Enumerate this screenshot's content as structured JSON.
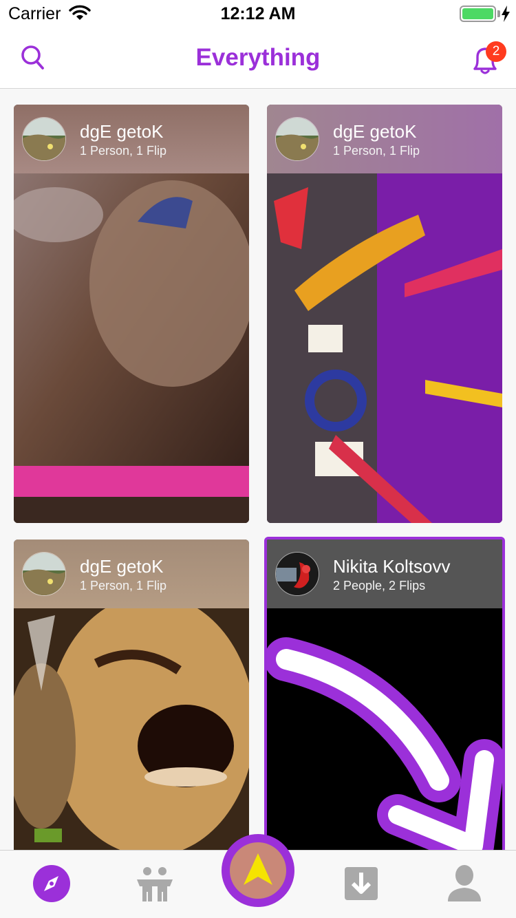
{
  "status_bar": {
    "carrier": "Carrier",
    "time": "12:12 AM",
    "battery_level": 1.0
  },
  "header": {
    "title": "Everything",
    "notification_count": "2",
    "icons": [
      "search-icon",
      "bell-icon"
    ]
  },
  "feed": {
    "cards": [
      {
        "name": "dgE getoK",
        "subtitle": "1 Person, 1 Flip",
        "selected": false
      },
      {
        "name": "dgE getoK",
        "subtitle": "1 Person, 1 Flip",
        "selected": false
      },
      {
        "name": "dgE getoK",
        "subtitle": "1 Person, 1 Flip",
        "selected": false
      },
      {
        "name": "Nikita Koltsovv",
        "subtitle": "2 People, 2 Flips",
        "selected": true
      }
    ]
  },
  "tab_bar": {
    "tabs": [
      "explore-compass-icon",
      "people-icon",
      "create-arrow-icon",
      "download-icon",
      "profile-icon"
    ],
    "active_tab": "explore-compass-icon"
  },
  "colors": {
    "accent": "#9b30d9",
    "badge": "#ff3b1f",
    "fab_center": "#c98878",
    "fab_arrow": "#f5e400",
    "tab_inactive": "#a9a9a9"
  }
}
